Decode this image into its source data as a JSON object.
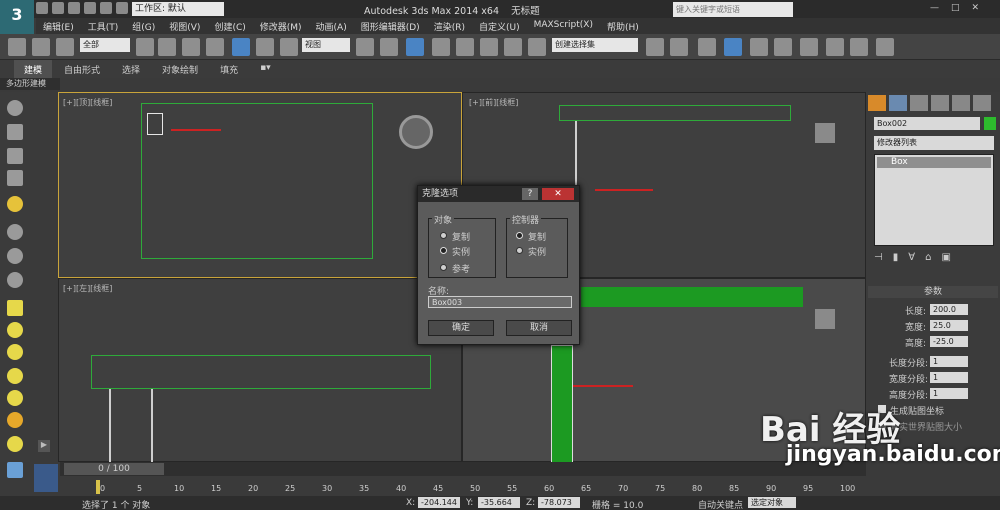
{
  "app": {
    "title": "Autodesk 3ds Max  2014 x64",
    "file": "无标题",
    "workspace": "工作区: 默认",
    "search_placeholder": "键入关键字或短语",
    "logo": "3"
  },
  "menu": [
    "编辑(E)",
    "工具(T)",
    "组(G)",
    "视图(V)",
    "创建(C)",
    "修改器(M)",
    "动画(A)",
    "图形编辑器(D)",
    "渲染(R)",
    "自定义(U)",
    "MAXScript(X)",
    "帮助(H)"
  ],
  "toolbar": {
    "filter": "全部",
    "ref_coord": "视图",
    "selection_set": "创建选择集"
  },
  "ribbon": {
    "tabs": [
      "建模",
      "自由形式",
      "选择",
      "对象绘制",
      "填充"
    ],
    "active": 0,
    "sub": "多边形建模"
  },
  "viewports": {
    "top": "[+][顶][线框]",
    "front": "[+][前][线框]",
    "left": "[+][左][线框]"
  },
  "command_panel": {
    "name": "Box002",
    "modifier_list": "修改器列表",
    "stack_item": "Box",
    "params": {
      "title": "参数",
      "length_label": "长度:",
      "length": "200.0",
      "width_label": "宽度:",
      "width": "25.0",
      "height_label": "高度:",
      "height": "-25.0",
      "lseg_label": "长度分段:",
      "lseg": "1",
      "wseg_label": "宽度分段:",
      "wseg": "1",
      "hseg_label": "高度分段:",
      "hseg": "1",
      "gen_map": "生成贴图坐标",
      "real_world": "真实世界贴图大小"
    }
  },
  "dialog": {
    "title": "克隆选项",
    "object_group": "对象",
    "object_opts": [
      "复制",
      "实例",
      "参考"
    ],
    "object_selected": 1,
    "ctrl_group": "控制器",
    "ctrl_opts": [
      "复制",
      "实例"
    ],
    "ctrl_selected": 0,
    "name_label": "名称:",
    "name_value": "Box003",
    "ok": "确定",
    "cancel": "取消"
  },
  "timeline": {
    "frame": "0 / 100",
    "ticks": [
      "0",
      "5",
      "10",
      "15",
      "20",
      "25",
      "30",
      "35",
      "40",
      "45",
      "50",
      "55",
      "60",
      "65",
      "70",
      "75",
      "80",
      "85",
      "90",
      "95",
      "100"
    ]
  },
  "status": {
    "message": "选择了 1 个 对象",
    "x_label": "X:",
    "x": "-204.144",
    "y_label": "Y:",
    "y": "-35.664",
    "z_label": "Z:",
    "z": "-78.073",
    "grid": "栅格 = 10.0",
    "autokey": "自动关键点",
    "selected": "选定对象"
  },
  "watermark": {
    "brand": "Bai 经验",
    "url": "jingyan.baidu.com"
  }
}
